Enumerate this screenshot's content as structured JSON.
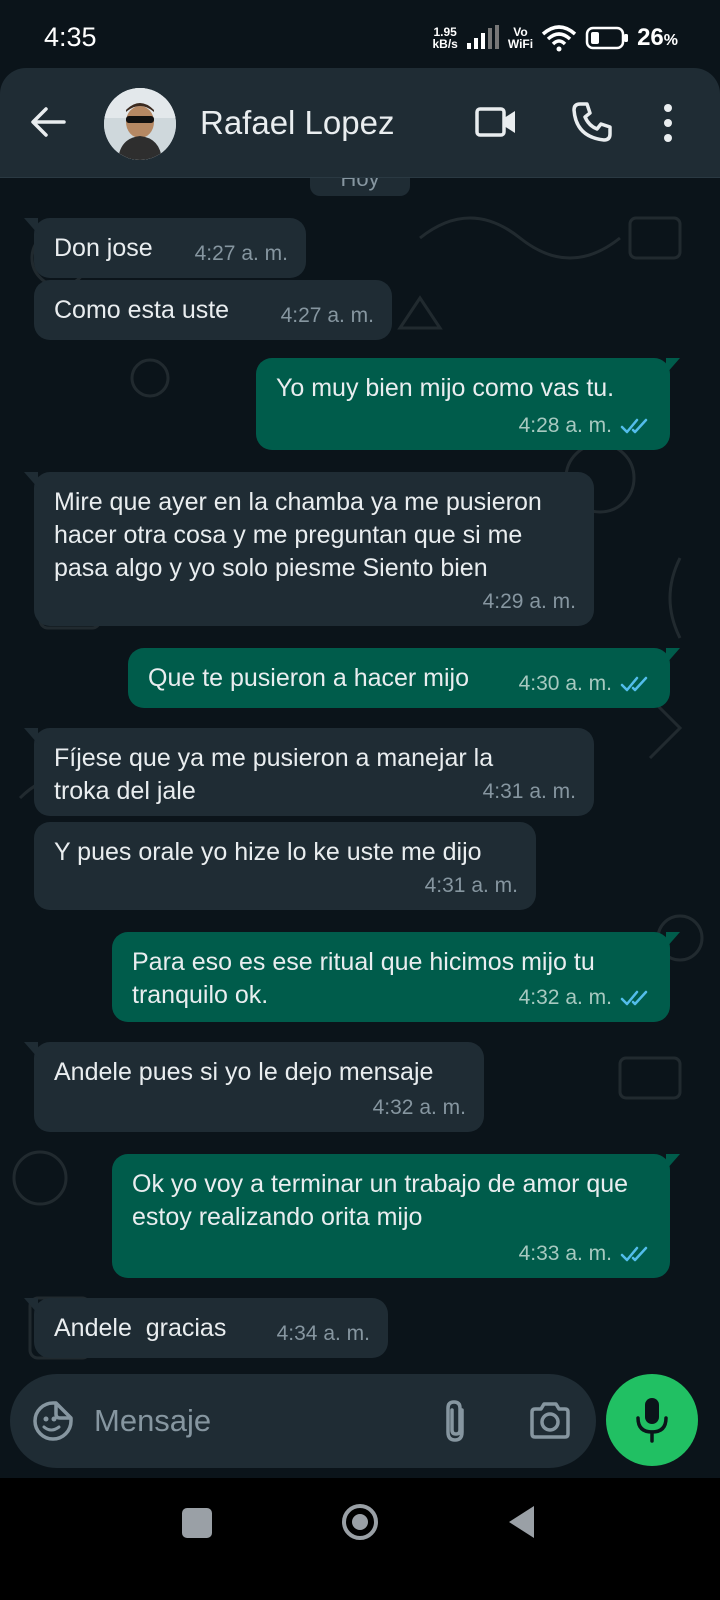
{
  "status_bar": {
    "time": "4:35",
    "speed_value": "1.95",
    "speed_unit": "kB/s",
    "vo_label": "Vo",
    "wifi_label": "WiFi",
    "battery_percent": "26",
    "battery_unit": "%"
  },
  "header": {
    "contact_name": "Rafael Lopez"
  },
  "date_chip": "Hoy",
  "messages": [
    {
      "dir": "in",
      "text": "Don jose",
      "time": "4:27 a. m."
    },
    {
      "dir": "in",
      "text": "Como esta uste",
      "time": "4:27 a. m."
    },
    {
      "dir": "out",
      "text": "Yo muy bien mijo como vas tu.",
      "time": "4:28 a. m.",
      "status": "read"
    },
    {
      "dir": "in",
      "text": "Mire que ayer en la chamba ya me pusieron hacer otra cosa y me preguntan que si me pasa algo y yo solo piesme Siento bien",
      "time": "4:29 a. m."
    },
    {
      "dir": "out",
      "text": "Que te pusieron a hacer mijo",
      "time": "4:30 a. m.",
      "status": "read"
    },
    {
      "dir": "in",
      "text": "Fíjese que ya me pusieron a manejar la troka del jale",
      "time": "4:31 a. m."
    },
    {
      "dir": "in",
      "text": "Y pues orale yo hize lo ke uste me dijo",
      "time": "4:31 a. m."
    },
    {
      "dir": "out",
      "text": "Para eso es ese ritual que hicimos mijo tu tranquilo ok.",
      "time": "4:32 a. m.",
      "status": "read"
    },
    {
      "dir": "in",
      "text": "Andele pues si yo le dejo mensaje",
      "time": "4:32 a. m."
    },
    {
      "dir": "out",
      "text": "Ok yo voy a terminar un trabajo de amor que estoy realizando orita mijo",
      "time": "4:33 a. m.",
      "status": "read"
    },
    {
      "dir": "in",
      "text": "Andele  gracias",
      "time": "4:34 a. m."
    }
  ],
  "composer": {
    "placeholder": "Mensaje"
  },
  "colors": {
    "background": "#0b141a",
    "header": "#1f2c34",
    "incoming_bubble": "#1f2c34",
    "outgoing_bubble": "#005c4b",
    "accent_green": "#21c063",
    "read_ticks": "#53bdeb"
  },
  "icons": {
    "back": "arrow-left-icon",
    "video": "video-camera-icon",
    "call": "phone-icon",
    "more": "more-vertical-icon",
    "emoji": "sticker-smiley-icon",
    "attach": "paperclip-icon",
    "camera": "camera-icon",
    "mic": "microphone-icon"
  }
}
